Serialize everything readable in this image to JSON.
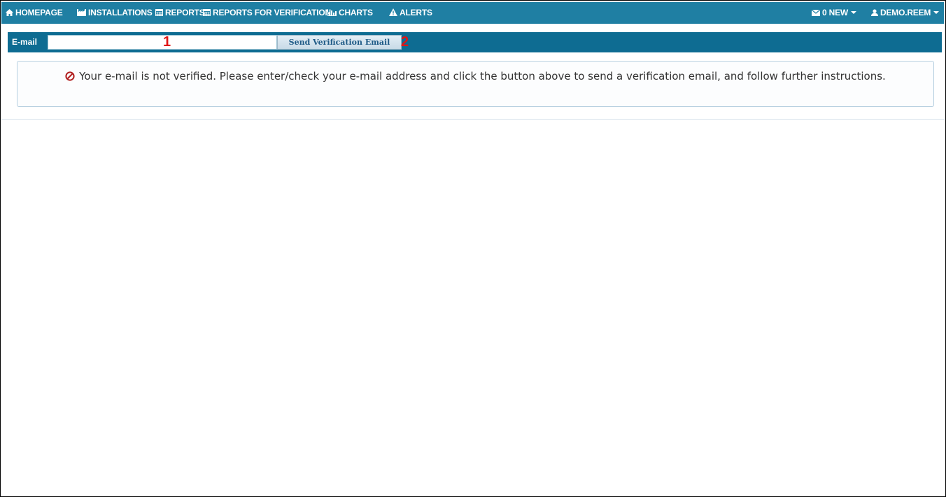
{
  "nav": {
    "items": [
      {
        "label": "HOMEPAGE",
        "icon": "home-icon"
      },
      {
        "label": "INSTALLATIONS",
        "icon": "factory-icon"
      },
      {
        "label": "REPORTS",
        "icon": "calendar-icon"
      },
      {
        "label": "REPORTS FOR VERIFICATION",
        "icon": "calendar-icon"
      },
      {
        "label": "CHARTS",
        "icon": "bar-chart-icon"
      },
      {
        "label": "ALERTS",
        "icon": "warning-icon"
      }
    ],
    "messages": {
      "label": "0 NEW",
      "icon": "envelope-icon"
    },
    "user": {
      "label": "DEMO.REEM",
      "icon": "user-icon"
    }
  },
  "email_bar": {
    "label": "E-mail",
    "input_value": "",
    "button_label": "Send Verification Email",
    "marker_1": "1",
    "marker_2": "2"
  },
  "alert": {
    "icon": "ban-icon",
    "message": "Your e-mail is not verified. Please enter/check your e-mail address and click the button above to send a verification email, and follow further instructions."
  },
  "colors": {
    "nav_bg": "#1f7fa3",
    "email_bar_bg": "#0e6c92",
    "button_text": "#1e5a86",
    "marker": "#e01515",
    "alert_icon": "#b11e1e"
  }
}
